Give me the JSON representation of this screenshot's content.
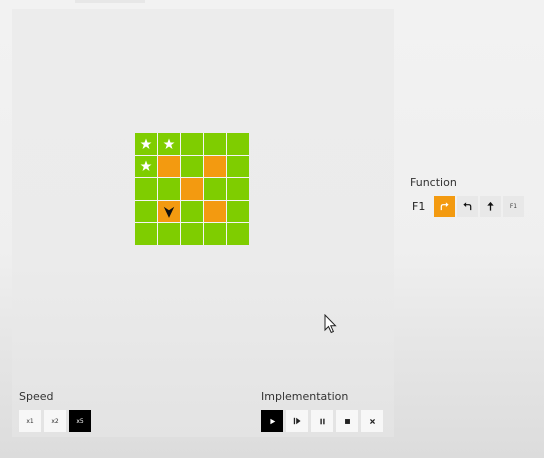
{
  "colors": {
    "grid_green": "#7fcd00",
    "grid_orange": "#f39a10",
    "active_black": "#000000",
    "button_bg": "#f7f7f7"
  },
  "grid": {
    "rows": 5,
    "cols": 5,
    "cells": [
      [
        "green",
        "green",
        "green",
        "green",
        "green"
      ],
      [
        "green",
        "orange",
        "green",
        "orange",
        "green"
      ],
      [
        "green",
        "green",
        "orange",
        "green",
        "green"
      ],
      [
        "green",
        "orange",
        "green",
        "orange",
        "green"
      ],
      [
        "green",
        "green",
        "green",
        "green",
        "green"
      ]
    ],
    "stars": [
      [
        0,
        0
      ],
      [
        0,
        1
      ],
      [
        1,
        0
      ]
    ],
    "robot": {
      "row": 3,
      "col": 1,
      "facing": "down"
    }
  },
  "speed": {
    "label": "Speed",
    "options": [
      "x1",
      "x2",
      "x5"
    ],
    "selected": "x5"
  },
  "implementation": {
    "label": "Implementation",
    "controls": [
      "play-icon",
      "step-icon",
      "pause-icon",
      "stop-icon",
      "clear-icon"
    ],
    "active": "play-icon"
  },
  "function": {
    "label": "Function",
    "name": "F1",
    "slots": [
      {
        "icon": "turn-right-icon",
        "highlight": true
      },
      {
        "icon": "turn-left-icon",
        "highlight": false
      },
      {
        "icon": "forward-icon",
        "highlight": false
      },
      {
        "icon": "call-f1",
        "text": "F1",
        "highlight": false
      }
    ]
  }
}
